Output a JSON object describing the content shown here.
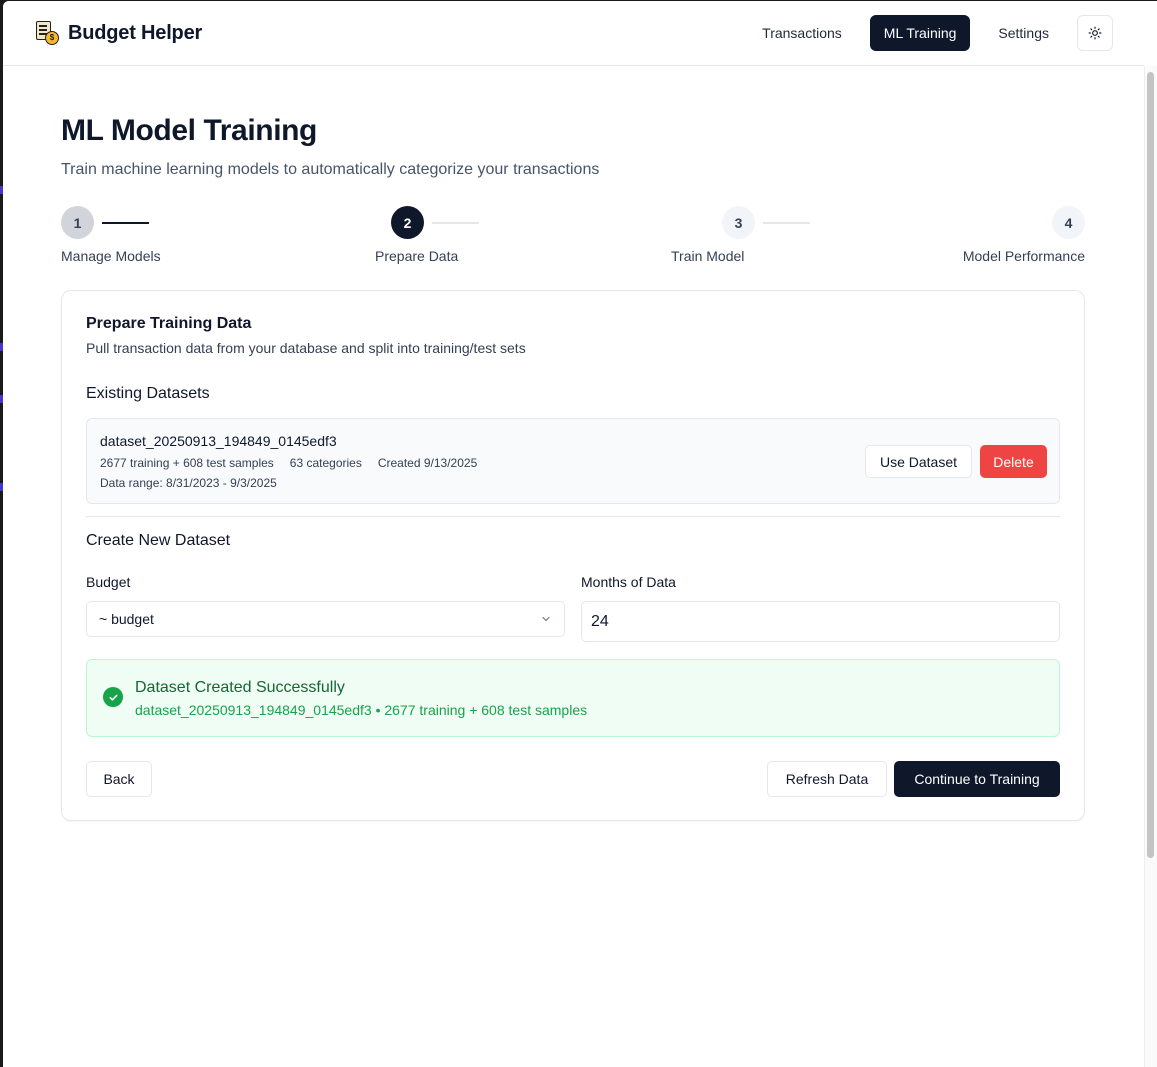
{
  "header": {
    "brand_name": "Budget Helper",
    "nav": [
      {
        "label": "Transactions",
        "active": false
      },
      {
        "label": "ML Training",
        "active": true
      },
      {
        "label": "Settings",
        "active": false
      }
    ],
    "theme_icon": "sun-icon"
  },
  "page": {
    "title": "ML Model Training",
    "subtitle": "Train machine learning models to automatically categorize your transactions"
  },
  "stepper": {
    "current_step": 2,
    "steps": [
      {
        "number": "1",
        "label": "Manage Models",
        "state": "completed"
      },
      {
        "number": "2",
        "label": "Prepare Data",
        "state": "active"
      },
      {
        "number": "3",
        "label": "Train Model",
        "state": "upcoming"
      },
      {
        "number": "4",
        "label": "Model Performance",
        "state": "upcoming"
      }
    ]
  },
  "card": {
    "title": "Prepare Training Data",
    "description": "Pull transaction data from your database and split into training/test sets",
    "existing_title": "Existing Datasets",
    "dataset": {
      "name": "dataset_20250913_194849_0145edf3",
      "samples": "2677 training + 608 test samples",
      "categories": "63 categories",
      "created": "Created 9/13/2025",
      "range": "Data range: 8/31/2023 - 9/3/2025",
      "use_label": "Use Dataset",
      "delete_label": "Delete"
    },
    "create_title": "Create New Dataset",
    "budget_label": "Budget",
    "budget_value": "~ budget",
    "months_label": "Months of Data",
    "months_value": "24",
    "alert": {
      "title": "Dataset Created Successfully",
      "message": "dataset_20250913_194849_0145edf3 • 2677 training + 608 test samples"
    },
    "back_label": "Back",
    "refresh_label": "Refresh Data",
    "continue_label": "Continue to Training"
  },
  "colors": {
    "primary": "#0f172a",
    "danger": "#ef4444",
    "success": "#16a34a",
    "success_bg": "#f0fdf4"
  }
}
